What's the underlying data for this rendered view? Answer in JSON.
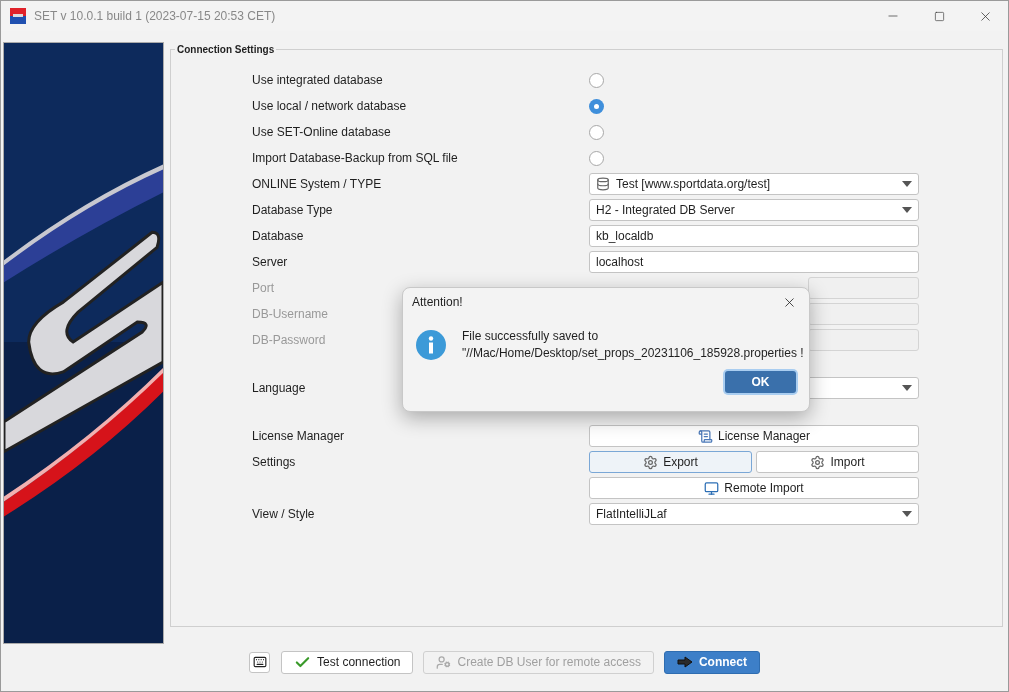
{
  "window": {
    "title": "SET v 10.0.1 build 1 (2023-07-15 20:53 CET)"
  },
  "group": {
    "title": "Connection Settings",
    "sections": [
      [
        {
          "kind": "radio",
          "label": "Use integrated database",
          "selected": false
        },
        {
          "kind": "radio",
          "label": "Use local / network database",
          "selected": true
        },
        {
          "kind": "radio",
          "label": "Use SET-Online database",
          "selected": false
        },
        {
          "kind": "radio",
          "label": "Import Database-Backup from SQL file",
          "selected": false
        },
        {
          "kind": "db-combo",
          "label": "ONLINE System / TYPE",
          "value": "Test [www.sportdata.org/test]"
        },
        {
          "kind": "combo",
          "label": "Database Type",
          "value": "H2 - Integrated DB Server"
        },
        {
          "kind": "field",
          "label": "Database",
          "value": "kb_localdb",
          "disabled": false
        },
        {
          "kind": "field",
          "label": "Server",
          "value": "localhost",
          "disabled": false
        },
        {
          "kind": "field",
          "label": "Port",
          "disabled": true
        },
        {
          "kind": "field",
          "label": "DB-Username",
          "disabled": true
        },
        {
          "kind": "field",
          "label": "DB-Password",
          "disabled": true
        }
      ],
      [
        {
          "kind": "combo",
          "label": "Language"
        }
      ],
      [
        {
          "kind": "buttons",
          "label": "License Manager",
          "buttons": [
            {
              "kind": "license",
              "label": "License Manager",
              "focused": false
            }
          ]
        },
        {
          "kind": "buttons",
          "label": "Settings",
          "buttons": [
            {
              "kind": "export",
              "label": "Export",
              "focused": true
            },
            {
              "kind": "import",
              "label": "Import",
              "focused": false
            }
          ]
        },
        {
          "kind": "buttons",
          "buttons": [
            {
              "kind": "remote",
              "label": "Remote Import",
              "focused": false
            }
          ]
        },
        {
          "kind": "combo",
          "label": "View / Style",
          "value": "FlatIntelliJLaf"
        }
      ]
    ]
  },
  "footer": [
    {
      "kind": "keyboard"
    },
    {
      "kind": "test",
      "label": "Test connection",
      "disabled": false,
      "primary": false
    },
    {
      "kind": "user",
      "label": "Create DB User for remote access",
      "disabled": true,
      "primary": false
    },
    {
      "kind": "connect",
      "label": "Connect",
      "disabled": false,
      "primary": true
    }
  ],
  "dialog": {
    "title": "Attention!",
    "lines": [
      "File successfully saved to",
      "\"//Mac/Home/Desktop/set_props_20231106_185928.properties !"
    ],
    "button": "OK"
  }
}
